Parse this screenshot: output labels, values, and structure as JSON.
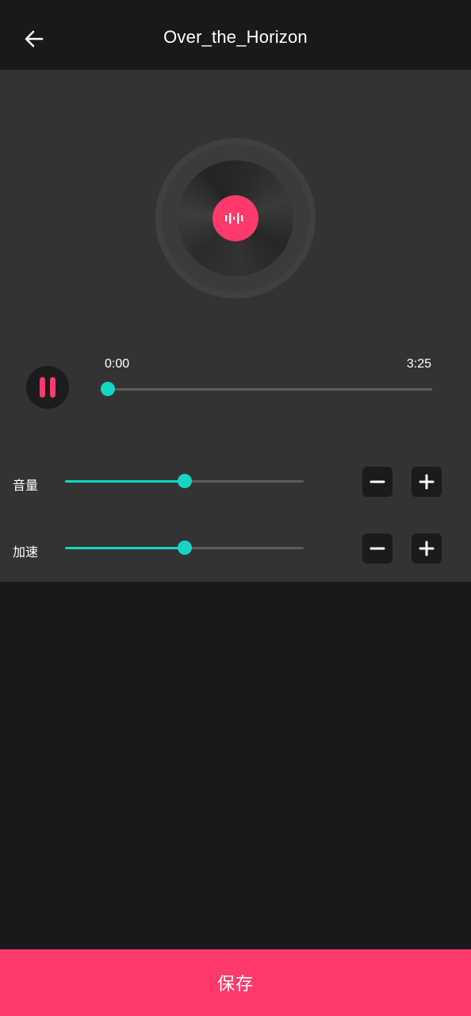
{
  "header": {
    "title": "Over_the_Horizon",
    "back_icon": "arrow-left-icon"
  },
  "player": {
    "disc_icon": "audio-wave-icon",
    "state": "playing",
    "pause_icon": "pause-icon",
    "current_time": "0:00",
    "total_time": "3:25",
    "progress": 0.0
  },
  "volume": {
    "label": "音量",
    "level": 0.5,
    "minus_icon": "minus-icon",
    "plus_icon": "plus-icon"
  },
  "speed": {
    "label": "加速",
    "level": 0.5,
    "minus_icon": "minus-icon",
    "plus_icon": "plus-icon"
  },
  "footer": {
    "save_label": "保存"
  },
  "colors": {
    "accent": "#15d6c3",
    "brand": "#fe3a6b",
    "panel": "#333333",
    "background": "#19191b"
  }
}
